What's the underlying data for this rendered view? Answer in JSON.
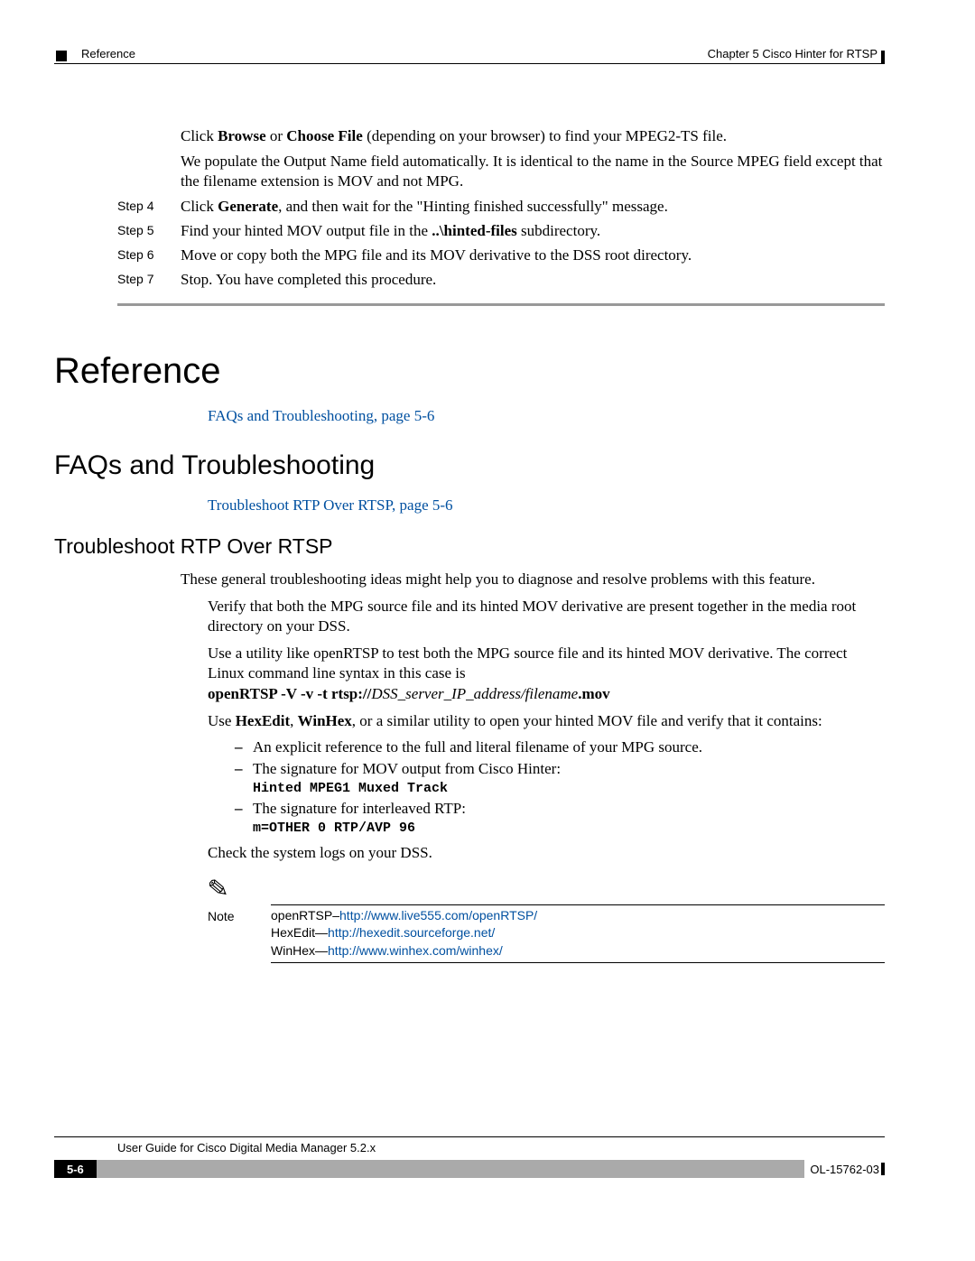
{
  "header": {
    "section": "Reference",
    "chapter": "Chapter 5      Cisco Hinter for RTSP"
  },
  "intro": {
    "p1": "Click Browse or Choose File (depending on your browser) to find your MPEG2-TS file.",
    "p2": "We populate the Output Name field automatically. It is identical to the name in the Source MPEG field except that the filename extension is MOV and not MPG."
  },
  "steps": [
    {
      "label": "Step 4",
      "pre": "Click ",
      "bold": "Generate",
      "post": ", and then wait for the \"Hinting finished successfully\" message."
    },
    {
      "label": "Step 5",
      "pre": "Find your hinted MOV output file in the ",
      "bold": "..\\hinted-files",
      "post": " subdirectory."
    },
    {
      "label": "Step 6",
      "pre": "Move or copy both the MPG file and its MOV derivative to the DSS root directory.",
      "bold": "",
      "post": ""
    },
    {
      "label": "Step 7",
      "pre": "Stop. You have completed this procedure.",
      "bold": "",
      "post": ""
    }
  ],
  "sections": {
    "reference": "Reference",
    "faqs": "FAQs and Troubleshooting",
    "trouble": "Troubleshoot RTP Over RTSP"
  },
  "xrefs": {
    "faqs": "FAQs and Troubleshooting, page 5-6",
    "trouble": "Troubleshoot RTP Over RTSP, page 5-6"
  },
  "trouble": {
    "intro": "These general troubleshooting ideas might help you to diagnose and resolve problems with this feature.",
    "verify": "Verify that both the MPG source file and its hinted MOV derivative are present together in the media root directory on your DSS.",
    "use_pre": "Use a utility like openRTSP to test both the MPG source file and its hinted MOV derivative. The correct Linux command line syntax in this case is",
    "cmd_bold1": "openRTSP -V -v -t rtsp://",
    "cmd_italic": "DSS_server_IP_address/filename",
    "cmd_bold2": ".mov",
    "hex_pre": "Use ",
    "hex_b1": "HexEdit",
    "hex_mid1": ", ",
    "hex_b2": "WinHex",
    "hex_post": ", or a similar utility to open your hinted MOV file and verify that it contains:",
    "bullet1": "An explicit reference to the full and literal filename of your MPG source.",
    "bullet2": "The signature for MOV output from Cisco Hinter:",
    "bullet2_code": "Hinted MPEG1 Muxed Track",
    "bullet3": "The signature for interleaved RTP:",
    "bullet3_code": "m=OTHER 0 RTP/AVP 96",
    "check": "Check the system logs on your DSS."
  },
  "note": {
    "label": "Note",
    "l1a": "openRTSP–",
    "l1b": "http://www.live555.com/openRTSP/",
    "l2a": "HexEdit—",
    "l2b": "http://hexedit.sourceforge.net/",
    "l3a": "WinHex—",
    "l3b": "http://www.winhex.com/winhex/"
  },
  "footer": {
    "title": "User Guide for Cisco Digital Media Manager 5.2.x",
    "pagenum": "5-6",
    "docid": "OL-15762-03"
  }
}
